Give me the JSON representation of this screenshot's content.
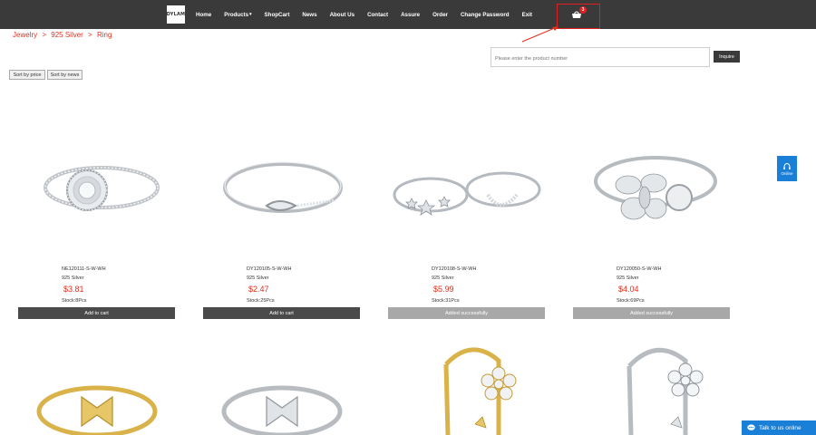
{
  "header": {
    "logo_text": "DYLAM",
    "nav": [
      {
        "label": "Home"
      },
      {
        "label": "Products"
      },
      {
        "label": "ShopCart"
      },
      {
        "label": "News"
      },
      {
        "label": "About Us"
      },
      {
        "label": "Contact"
      },
      {
        "label": "Assure"
      },
      {
        "label": "Order"
      },
      {
        "label": "Change Password"
      },
      {
        "label": "Exit"
      }
    ],
    "cart_count": "3",
    "cart_icon": "cart-icon"
  },
  "breadcrumb": {
    "items": [
      "Jewelry",
      ">",
      "925 Silver",
      ">",
      "Ring"
    ]
  },
  "search": {
    "placeholder": "Please enter the product number",
    "button_label": "Inquire"
  },
  "sort": {
    "price_label": "Sort by price",
    "news_label": "Sort by news"
  },
  "products": [
    {
      "code": "NE120111-S-W-WH",
      "metal": "925 Silver",
      "price": "$3.81",
      "stock": "Stock:8Pcs",
      "button": "Add to cart",
      "state": "add"
    },
    {
      "code": "DY120105-S-W-WH",
      "metal": "925 Silver",
      "price": "$2.47",
      "stock": "Stock:25Pcs",
      "button": "Add to cart",
      "state": "add"
    },
    {
      "code": "DY120108-S-W-WH",
      "metal": "925 Silver",
      "price": "$5.99",
      "stock": "Stock:31Pcs",
      "button": "Added successfully",
      "state": "added"
    },
    {
      "code": "DY120050-S-W-WH",
      "metal": "925 Silver",
      "price": "$4.04",
      "stock": "Stock:69Pcs",
      "button": "Added successfully",
      "state": "added"
    }
  ],
  "colors": {
    "nav_bg": "#3a3a3a",
    "accent_red": "#e0301e",
    "chat_blue": "#1a7fd6"
  },
  "widgets": {
    "online_label": "Online",
    "talk_label": "Talk to us online"
  }
}
